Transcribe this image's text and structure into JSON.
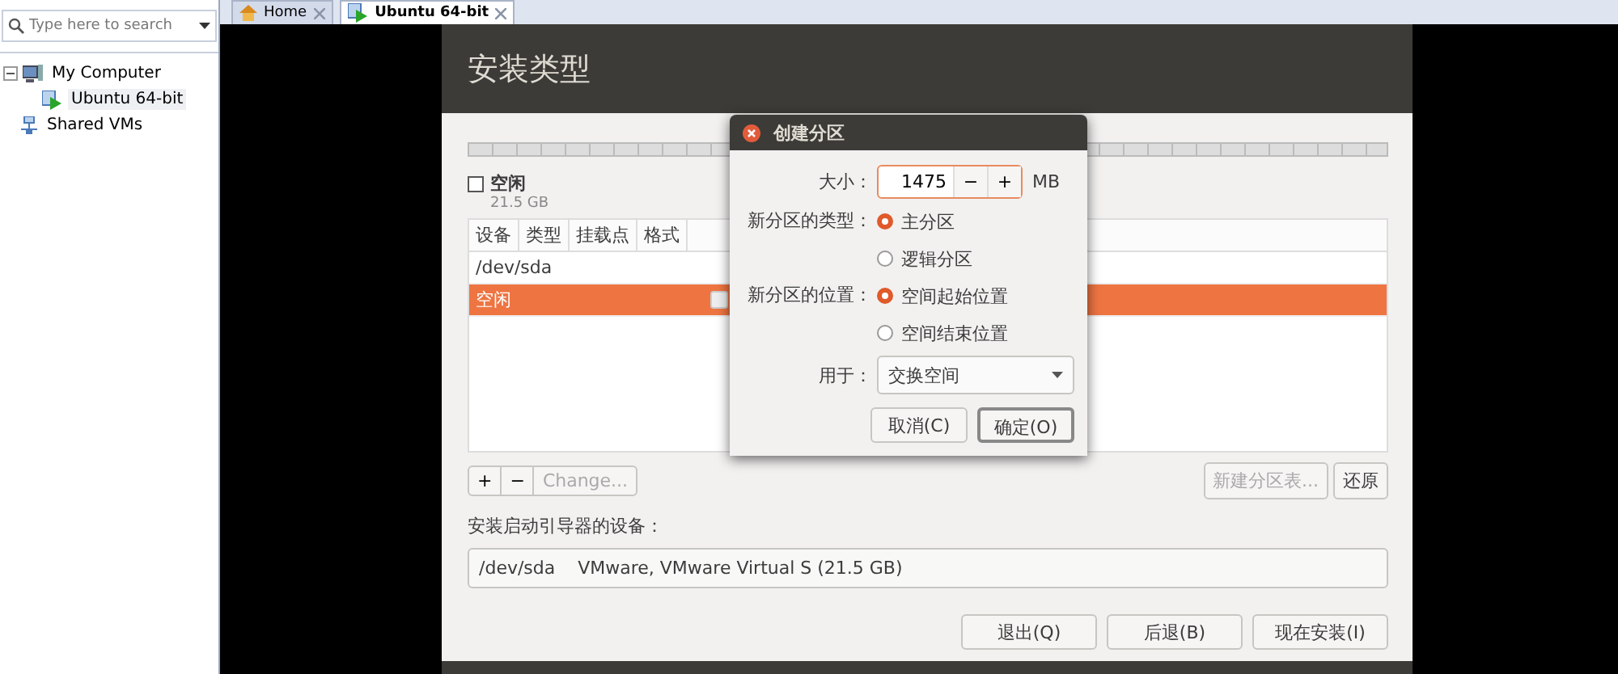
{
  "library": {
    "search": {
      "placeholder": "Type here to search"
    },
    "tree": [
      {
        "label": "My Computer",
        "expanded": true,
        "selected": false,
        "children": [
          {
            "label": "Ubuntu 64-bit",
            "selected": true
          }
        ]
      },
      {
        "label": "Shared VMs",
        "selected": false
      }
    ]
  },
  "tabs": [
    {
      "label": "Home",
      "selected": false
    },
    {
      "label": "Ubuntu 64-bit",
      "selected": true
    }
  ],
  "installer": {
    "title": "安装类型",
    "free_space": {
      "label": "空闲",
      "size": "21.5 GB",
      "checked": false
    },
    "table": {
      "columns": [
        "设备",
        "类型",
        "挂载点",
        "格式"
      ],
      "rows": [
        {
          "device": "/dev/sda",
          "selected": false
        },
        {
          "device": "空闲",
          "selected": true,
          "format_checked": false
        }
      ]
    },
    "add": "+",
    "remove": "−",
    "change": {
      "label": "Change...",
      "disabled": true
    },
    "new_table": {
      "label": "新建分区表...",
      "disabled": true
    },
    "revert": {
      "label": "还原",
      "disabled": false
    },
    "bootloader_label": "安装启动引导器的设备：",
    "bootloader_device": "/dev/sda    VMware, VMware Virtual S (21.5 GB)",
    "buttons": [
      {
        "label": "退出(Q)"
      },
      {
        "label": "后退(B)"
      },
      {
        "label": "现在安装(I)"
      }
    ]
  },
  "dialog": {
    "title": "创建分区",
    "size_label": "大小：",
    "size_value": "1475",
    "minus": "−",
    "plus": "+",
    "unit": "MB",
    "type_label": "新分区的类型：",
    "type_options": [
      {
        "label": "主分区",
        "selected": true
      },
      {
        "label": "逻辑分区",
        "selected": false
      }
    ],
    "location_label": "新分区的位置：",
    "location_options": [
      {
        "label": "空间起始位置",
        "selected": true
      },
      {
        "label": "空间结束位置",
        "selected": false
      }
    ],
    "use_label": "用于：",
    "use_value": "交换空间",
    "buttons": [
      {
        "label": "取消(C)",
        "default": false
      },
      {
        "label": "确定(O)",
        "default": true
      }
    ]
  }
}
